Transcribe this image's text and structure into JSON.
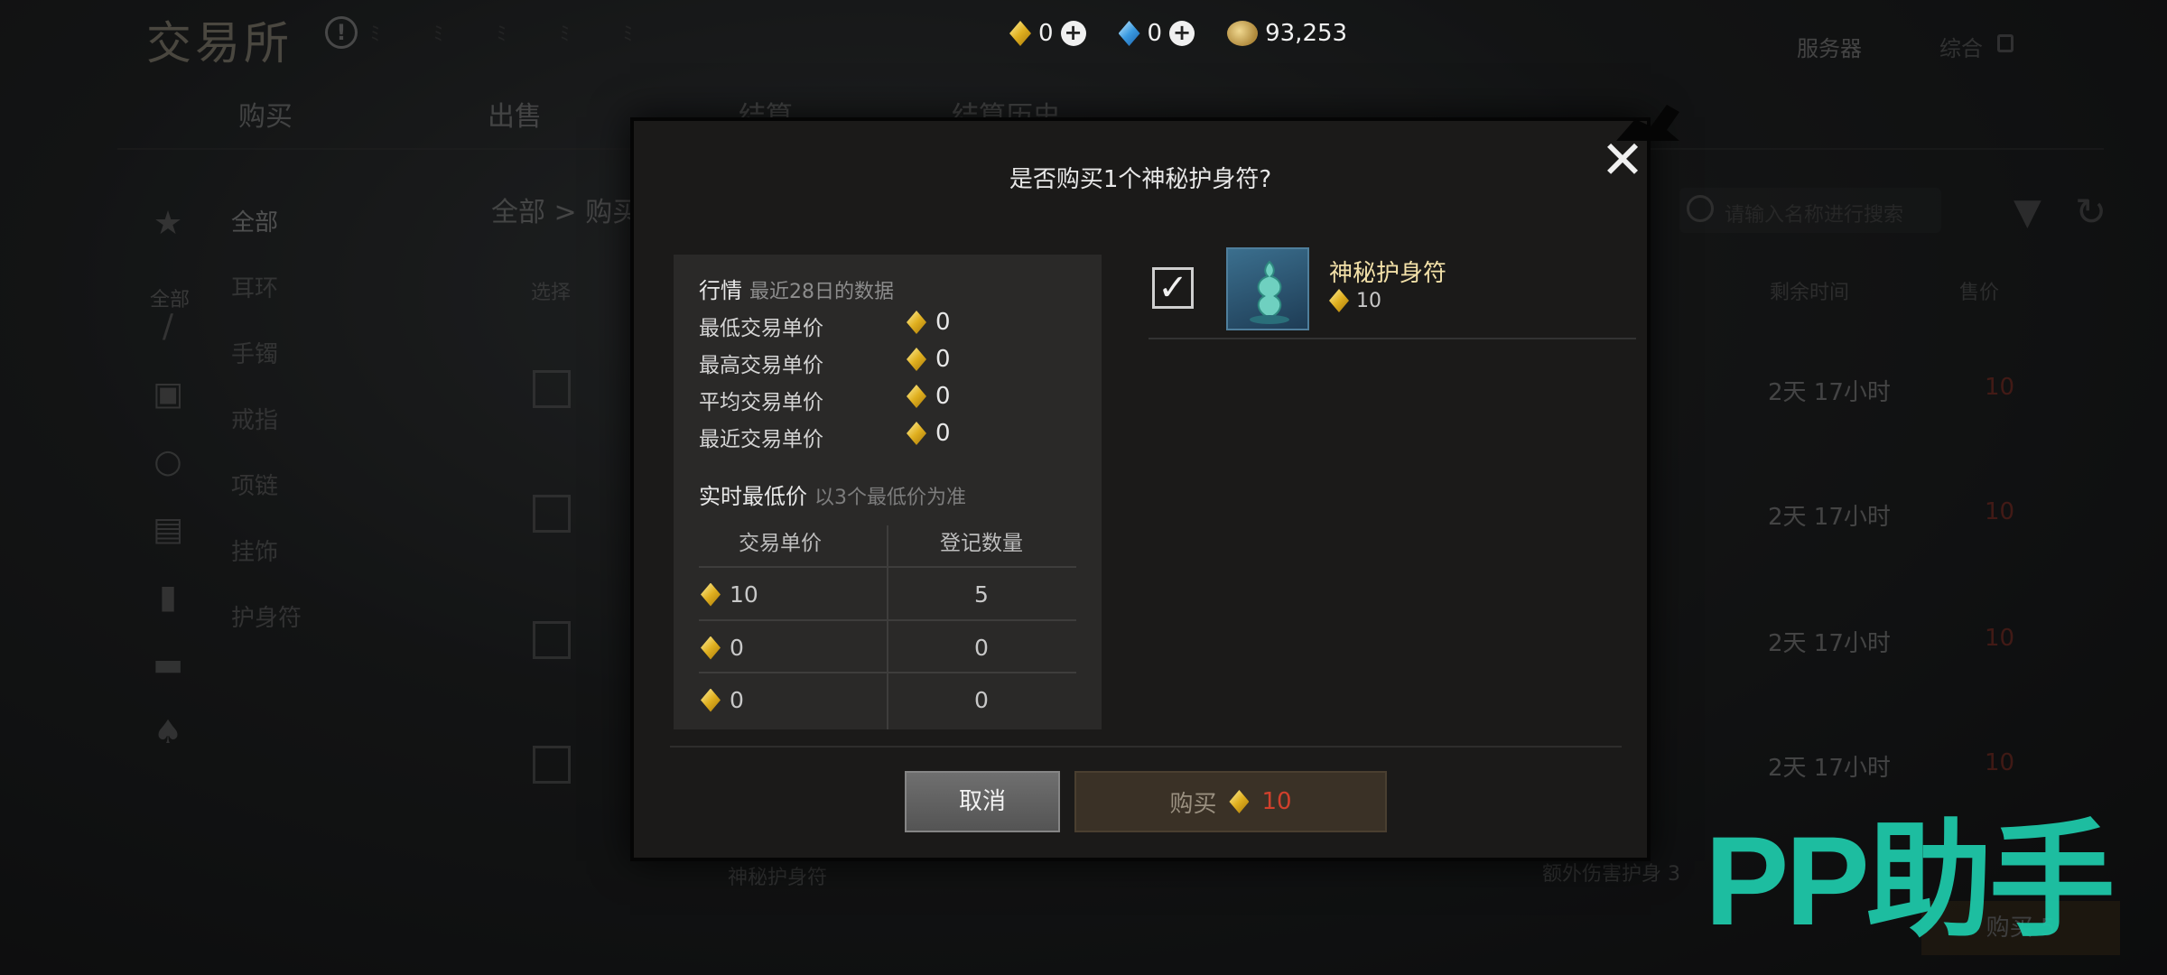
{
  "header": {
    "title": "交易所",
    "currencies": [
      {
        "icon": "gold-diamond-icon",
        "value": "0"
      },
      {
        "icon": "blue-diamond-icon",
        "value": "0"
      },
      {
        "icon": "coin-icon",
        "value": "93,253"
      }
    ],
    "server_label": "服务器",
    "combo_label": "综合"
  },
  "tabs": [
    "购买",
    "出售",
    "结算",
    "结算历史"
  ],
  "sidebar": {
    "all_label": "全部",
    "categories": [
      "全部",
      "耳环",
      "手镯",
      "戒指",
      "项链",
      "挂饰",
      "护身符"
    ]
  },
  "list": {
    "breadcrumb": "全部 > 购买",
    "select_header": "选择",
    "search_placeholder": "请输入名称进行搜索",
    "remain_header": "剩余时间",
    "price_header": "售价",
    "rows": [
      {
        "remain": "2天 17小时",
        "price": "10"
      },
      {
        "remain": "2天 17小时",
        "price": "10"
      },
      {
        "remain": "2天 17小时",
        "price": "10"
      },
      {
        "remain": "2天 17小时",
        "price": "10"
      }
    ],
    "bottom_item": "神秘护身符",
    "bottom_extra": "额外伤害护身 3",
    "bottom_button": "购买 5"
  },
  "dialog": {
    "title": "是否购买1个神秘护身符?",
    "market": {
      "heading": "行情",
      "subheading": "最近28日的数据",
      "rows": [
        {
          "label": "最低交易单价",
          "value": "0"
        },
        {
          "label": "最高交易单价",
          "value": "0"
        },
        {
          "label": "平均交易单价",
          "value": "0"
        },
        {
          "label": "最近交易单价",
          "value": "0"
        }
      ]
    },
    "live": {
      "heading": "实时最低价",
      "subheading": "以3个最低价为准",
      "col_price": "交易单价",
      "col_qty": "登记数量",
      "rows": [
        {
          "price": "10",
          "qty": "5"
        },
        {
          "price": "0",
          "qty": "0"
        },
        {
          "price": "0",
          "qty": "0"
        }
      ]
    },
    "item": {
      "name": "神秘护身符",
      "price": "10",
      "checked": true
    },
    "cancel_label": "取消",
    "buy_label": "购买",
    "buy_price": "10"
  },
  "watermark": "PP助手",
  "colors": {
    "accent_red": "#d0402c",
    "gold_text": "#f2e0a8",
    "watermark": "#1ec7a8"
  }
}
